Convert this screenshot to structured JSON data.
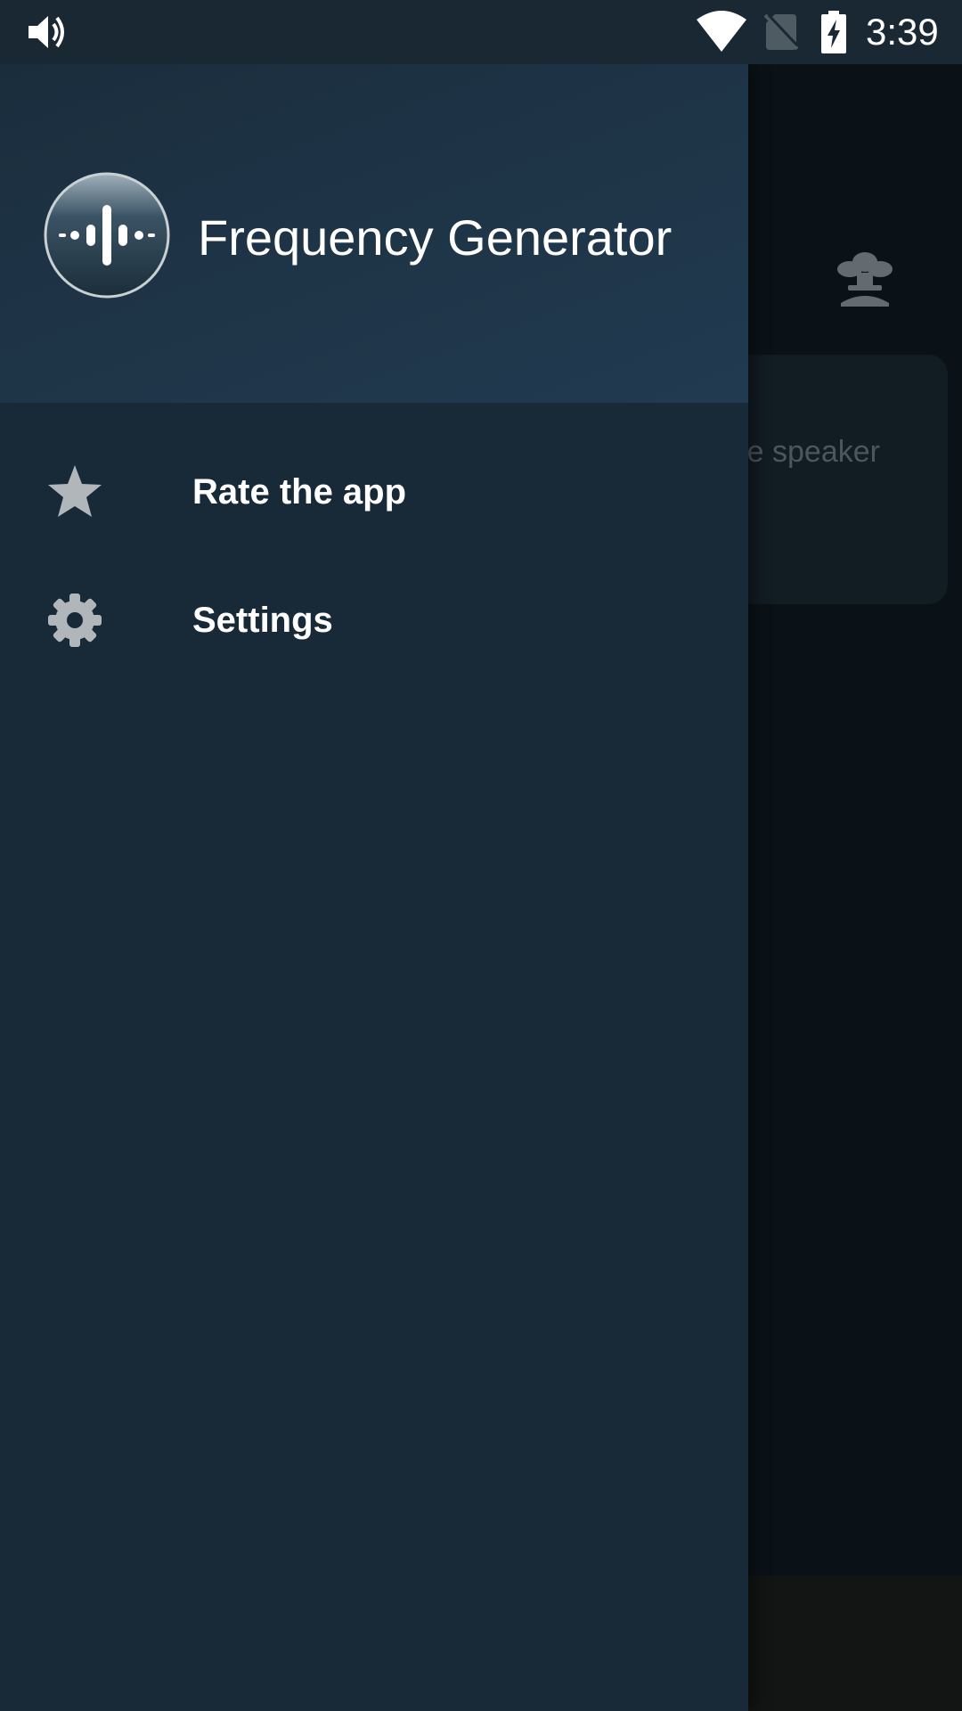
{
  "status_bar": {
    "time": "3:39",
    "icons": [
      "volume-icon",
      "wifi-icon",
      "no-sim-icon",
      "battery-charging-icon"
    ]
  },
  "drawer": {
    "app_title": "Frequency Generator",
    "logo_icon": "waveform-logo-icon",
    "menu": [
      {
        "label": "Rate the app",
        "icon": "star-icon"
      },
      {
        "label": "Settings",
        "icon": "gear-icon"
      }
    ]
  },
  "background": {
    "toolbar_icon": "speaker-cleaner-icon",
    "card_text": "e speaker"
  },
  "colors": {
    "status_bar": "#192833",
    "drawer": "#182937",
    "drawer_header": "#1f3649",
    "scrim": "#0b1217",
    "icon_gray": "#b0b6ba"
  }
}
